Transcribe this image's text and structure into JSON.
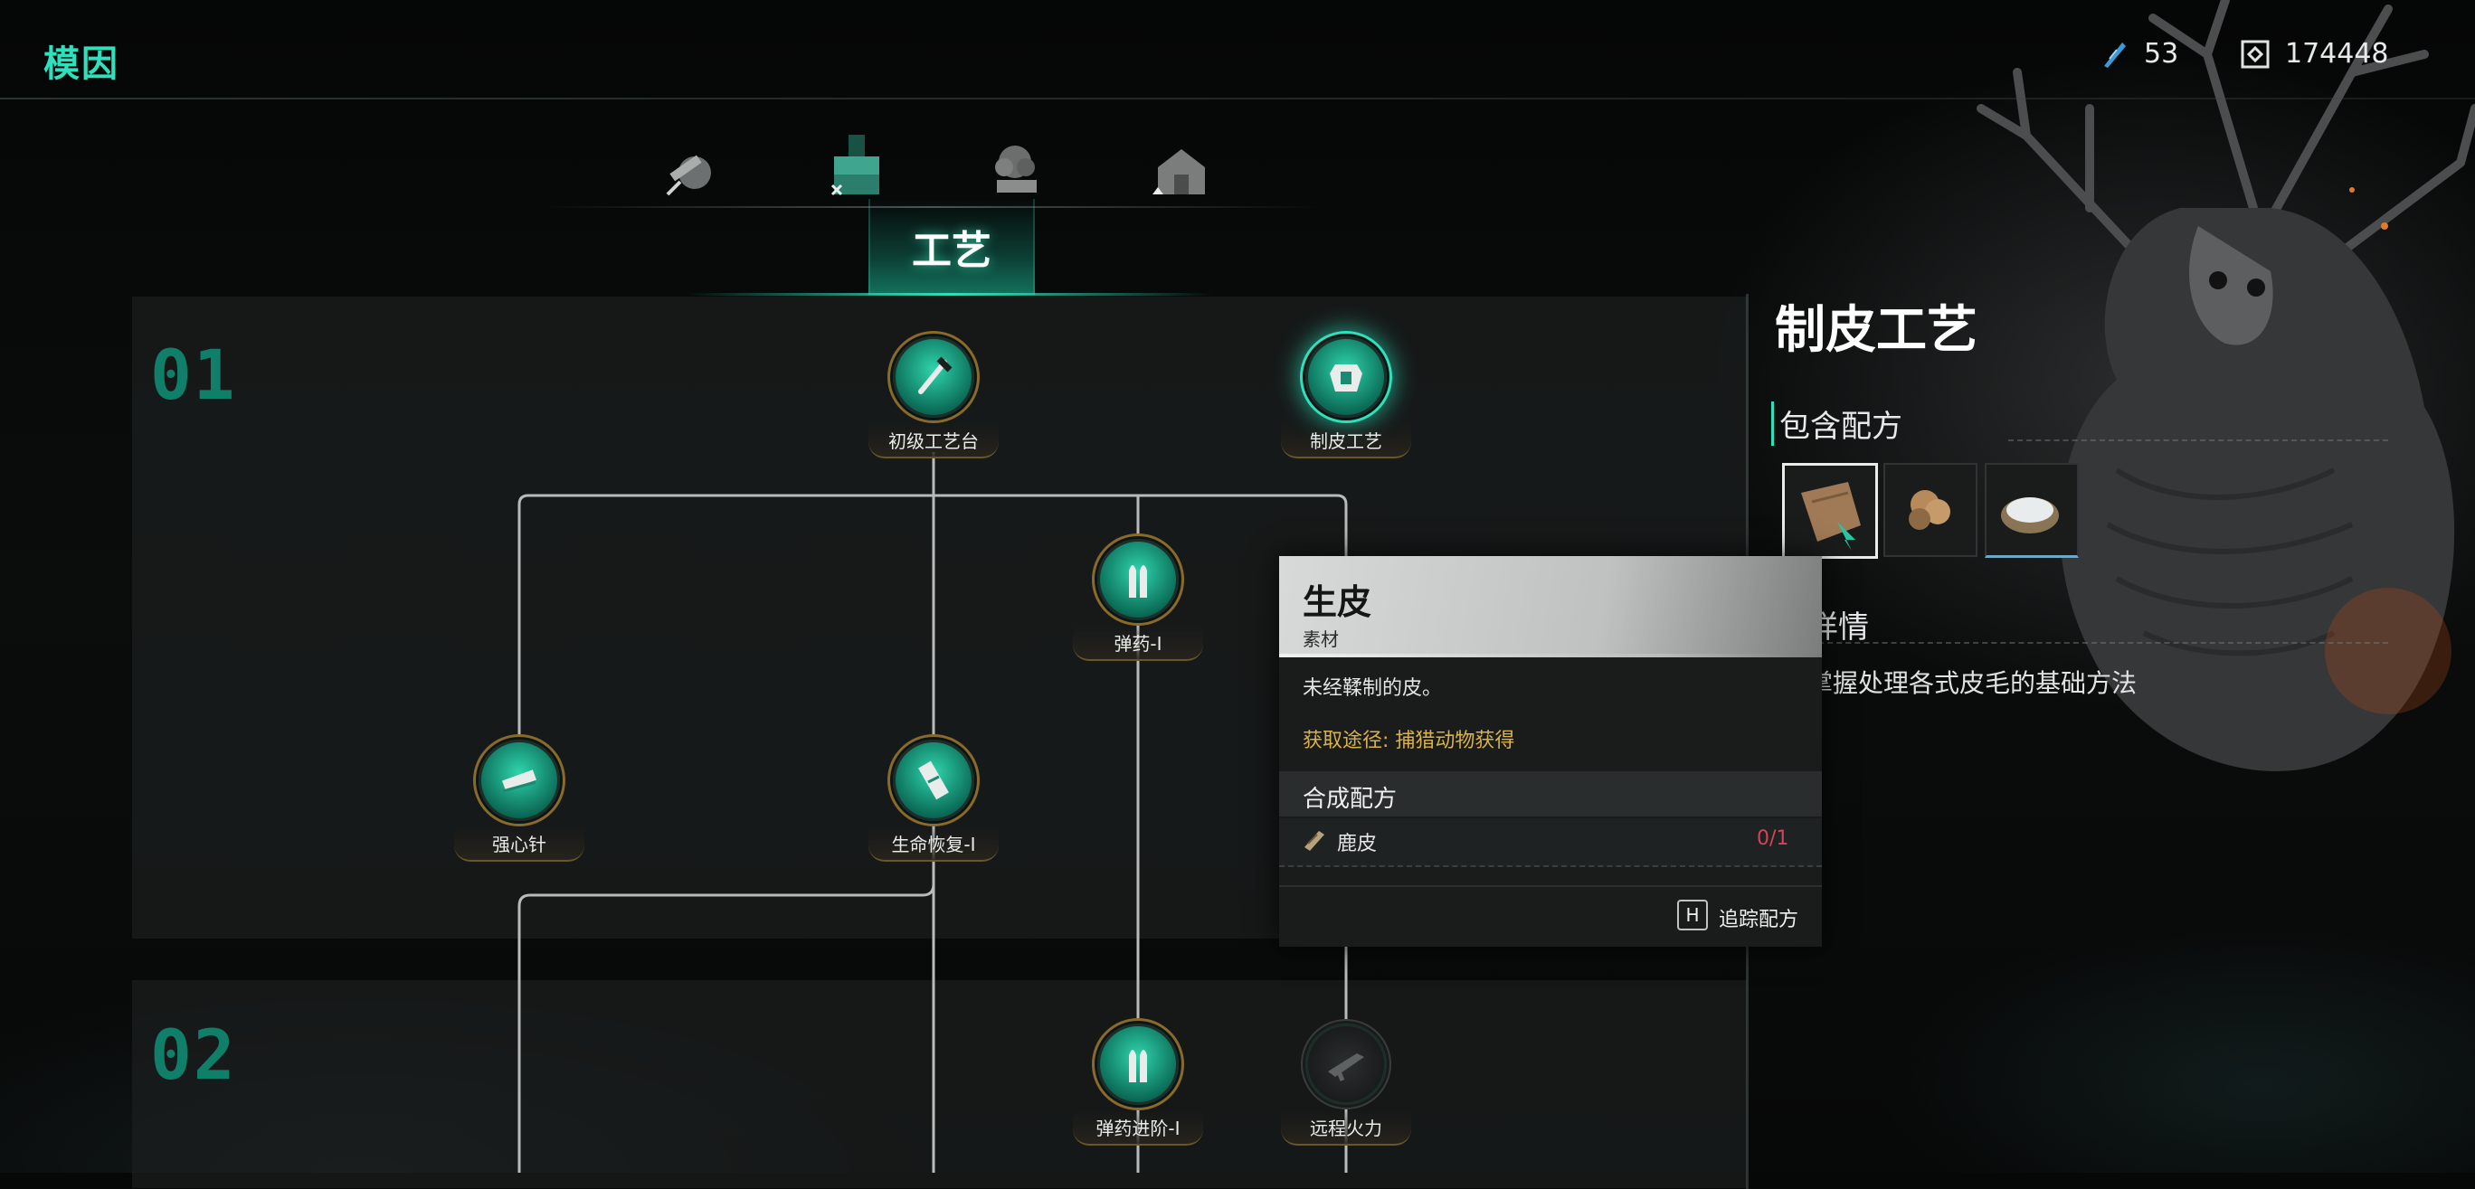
{
  "header": {
    "title": "模因",
    "currencies": [
      {
        "icon": "feather-shard-icon",
        "value": "53"
      },
      {
        "icon": "crafting-point-icon",
        "value": "174448"
      }
    ]
  },
  "categories": [
    {
      "icon": "gear-tools-icon",
      "selected": false
    },
    {
      "icon": "workbench-icon",
      "selected": true
    },
    {
      "icon": "plant-bed-icon",
      "selected": false
    },
    {
      "icon": "shelter-icon",
      "selected": false
    }
  ],
  "section_tab": "工艺",
  "tiers": [
    {
      "label": "01"
    },
    {
      "label": "02"
    }
  ],
  "nodes": {
    "basic_workbench": {
      "label": "初级工艺台"
    },
    "tanning_craft": {
      "label": "制皮工艺"
    },
    "ammo_1": {
      "label": "弹药-I"
    },
    "adrenaline": {
      "label": "强心针"
    },
    "health_restore_1": {
      "label": "生命恢复-I"
    },
    "ammo_advanced_1": {
      "label": "弹药进阶-I"
    },
    "ranged_firepower": {
      "label": "远程火力"
    }
  },
  "detail": {
    "title": "制皮工艺",
    "recipes_heading": "包含配方",
    "details_heading": "详情",
    "details_text": "掌握处理各式皮毛的基础方法"
  },
  "tooltip": {
    "name": "生皮",
    "category": "素材",
    "description": "未经鞣制的皮。",
    "source": "获取途径: 捕猎动物获得",
    "recipe_heading": "合成配方",
    "ingredients": [
      {
        "name": "鹿皮",
        "count": "0/1"
      }
    ],
    "track_key": "H",
    "track_label": "追踪配方"
  },
  "colors": {
    "accent": "#2ee0bc",
    "gold": "#d8b24a",
    "count_red": "#d0455a"
  }
}
